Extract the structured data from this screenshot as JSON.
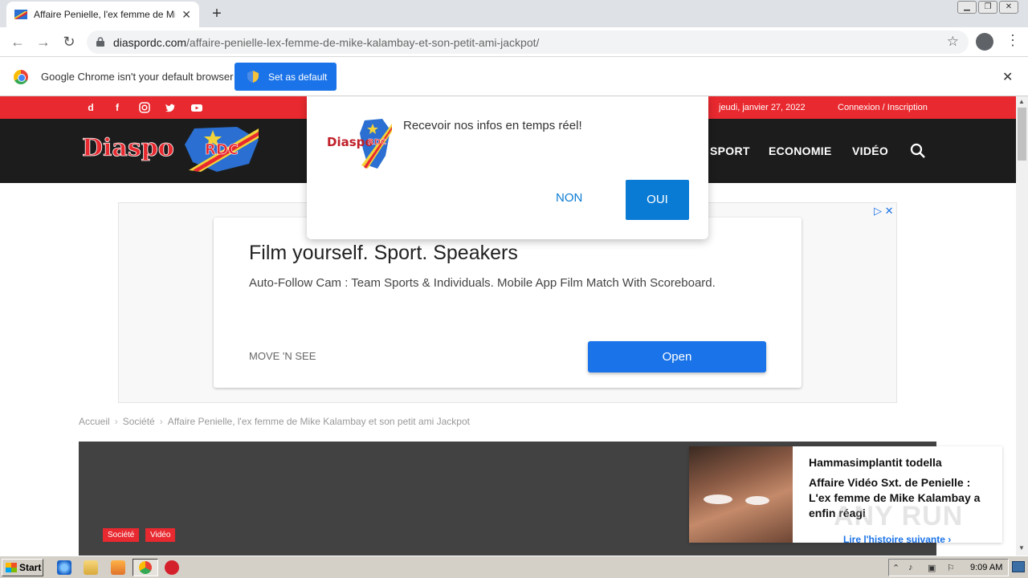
{
  "browser": {
    "tab_title": "Affaire Penielle, l'ex femme de Mike K",
    "new_tab_symbol": "+",
    "tab_close_symbol": "✕",
    "url_domain": "diaspordc.com",
    "url_path": "/affaire-penielle-lex-femme-de-mike-kalambay-et-son-petit-ami-jackpot/"
  },
  "infobar": {
    "message": "Google Chrome isn't your default browser",
    "button_label": "Set as default",
    "close_symbol": "✕"
  },
  "site": {
    "date": "jeudi, janvier 27, 2022",
    "login": "Connexion / Inscription",
    "nav": [
      "SPORT",
      "ECONOMIE",
      "VIDÉO"
    ],
    "logo_text_left": "Diaspo",
    "logo_text_right": "RDC",
    "brand_color": "#e8292f"
  },
  "push": {
    "logo_text_left": "Diaspo",
    "logo_text_right": "RDC",
    "message": "Recevoir nos infos en temps réel!",
    "no_label": "NON",
    "yes_label": "OUI"
  },
  "ad": {
    "headline": "Film yourself. Sport. Speakers",
    "description": "Auto-Follow Cam : Team Sports & Individuals. Mobile App Film Match With Scoreboard.",
    "brand": "MOVE 'N SEE",
    "cta": "Open",
    "marks": "▷ ✕"
  },
  "breadcrumb": {
    "home": "Accueil",
    "section": "Société",
    "current": "Affaire Penielle, l'ex femme de Mike Kalambay et son petit ami Jackpot",
    "separator": "›"
  },
  "hero": {
    "tags": [
      "Société",
      "Vidéo"
    ]
  },
  "next_story": {
    "title_top": "Hammasimplantit todella",
    "title": "Affaire Vidéo Sxt. de Penielle : L'ex femme de Mike Kalambay a enfin réagi",
    "link": "Lire l'histoire suivante ›",
    "watermark": "ANY RUN"
  },
  "taskbar": {
    "start_label": "Start",
    "clock": "9:09 AM"
  }
}
